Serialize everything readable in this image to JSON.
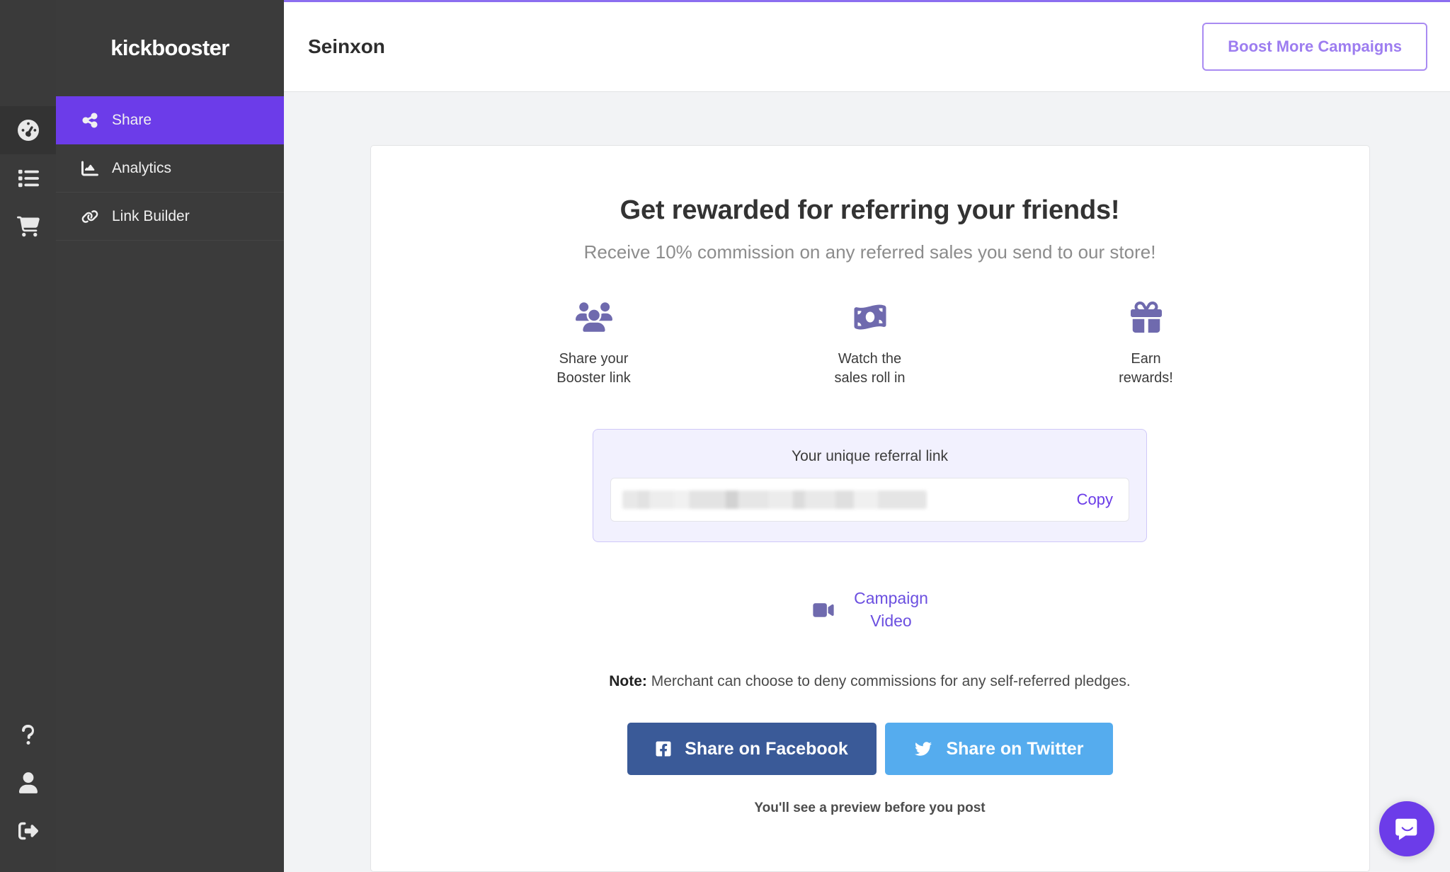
{
  "brand": {
    "logo_text": "kickbooster",
    "accent_purple": "#6c3ce9",
    "accent_light_purple": "#a98bf2",
    "icon_purple": "#6f6aae"
  },
  "rail": {
    "top_items": [
      {
        "name": "dashboard",
        "icon": "gauge-icon"
      },
      {
        "name": "campaigns",
        "icon": "list-icon"
      },
      {
        "name": "sales",
        "icon": "cart-icon"
      }
    ],
    "bottom_items": [
      {
        "name": "help",
        "icon": "question-mark-icon"
      },
      {
        "name": "account",
        "icon": "user-icon"
      },
      {
        "name": "logout",
        "icon": "sign-out-icon"
      }
    ]
  },
  "sidebar": {
    "items": [
      {
        "label": "Share",
        "icon": "share-icon",
        "active": true
      },
      {
        "label": "Analytics",
        "icon": "chart-area-icon",
        "active": false
      },
      {
        "label": "Link Builder",
        "icon": "link-icon",
        "active": false
      }
    ]
  },
  "topbar": {
    "title": "Seinxon",
    "boost_button_label": "Boost More Campaigns"
  },
  "card": {
    "headline": "Get rewarded for referring your friends!",
    "subhead": "Receive 10% commission on any referred sales you send to our store!",
    "steps": [
      {
        "label": "Share your\nBooster link",
        "icon": "users-icon"
      },
      {
        "label": "Watch the\nsales roll in",
        "icon": "money-bill-icon"
      },
      {
        "label": "Earn\nrewards!",
        "icon": "gift-icon"
      }
    ],
    "referral": {
      "title": "Your unique referral link",
      "value": "",
      "redacted": true,
      "copy_label": "Copy"
    },
    "video": {
      "label": "Campaign\nVideo",
      "icon": "video-camera-icon"
    },
    "note_prefix": "Note:",
    "note_body": " Merchant can choose to deny commissions for any self-referred pledges.",
    "share": {
      "facebook_label": "Share on Facebook",
      "facebook_color": "#3a5a98",
      "twitter_label": "Share on Twitter",
      "twitter_color": "#55acee"
    },
    "preview_note": "You'll see a preview before you post"
  },
  "chat": {
    "icon": "chat-bubble-smile-icon"
  }
}
